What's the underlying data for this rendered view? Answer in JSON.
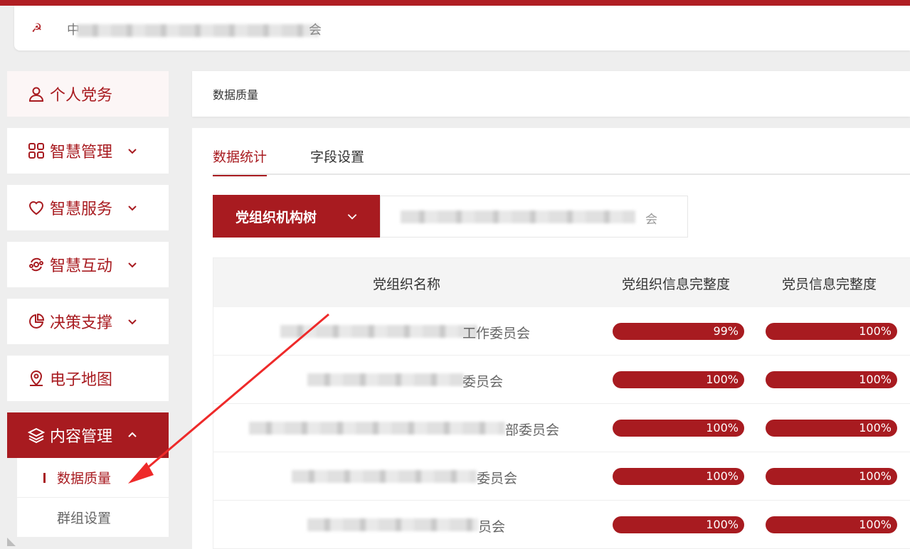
{
  "header": {
    "title_start": "中",
    "title_end": "会"
  },
  "sidebar": {
    "items": [
      {
        "label": "个人党务",
        "icon": "user-icon"
      },
      {
        "label": "智慧管理",
        "icon": "grid-icon"
      },
      {
        "label": "智慧服务",
        "icon": "heart-icon"
      },
      {
        "label": "智慧互动",
        "icon": "interaction-icon"
      },
      {
        "label": "决策支撑",
        "icon": "pie-chart-icon"
      },
      {
        "label": "电子地图",
        "icon": "map-pin-icon"
      },
      {
        "label": "内容管理",
        "icon": "layers-icon"
      }
    ],
    "sub_items": [
      {
        "label": "数据质量"
      },
      {
        "label": "群组设置"
      }
    ]
  },
  "breadcrumb": {
    "current": "数据质量"
  },
  "tabs": [
    {
      "label": "数据统计"
    },
    {
      "label": "字段设置"
    }
  ],
  "filter": {
    "tree_button": "党组织机构树",
    "org_tail": "会"
  },
  "table": {
    "headers": [
      "党组织名称",
      "党组织信息完整度",
      "党员信息完整度"
    ],
    "rows": [
      {
        "name": "工作委员会",
        "org_completeness": "99%",
        "member_completeness": "100%"
      },
      {
        "name": "委员会",
        "org_completeness": "100%",
        "member_completeness": "100%"
      },
      {
        "name": "部委员会",
        "org_completeness": "100%",
        "member_completeness": "100%"
      },
      {
        "name": "委员会",
        "org_completeness": "100%",
        "member_completeness": "100%"
      },
      {
        "name": "员会",
        "org_completeness": "100%",
        "member_completeness": "100%"
      }
    ]
  },
  "colors": {
    "brand_red": "#a81b20",
    "arrow_red": "#ee2a2a"
  }
}
